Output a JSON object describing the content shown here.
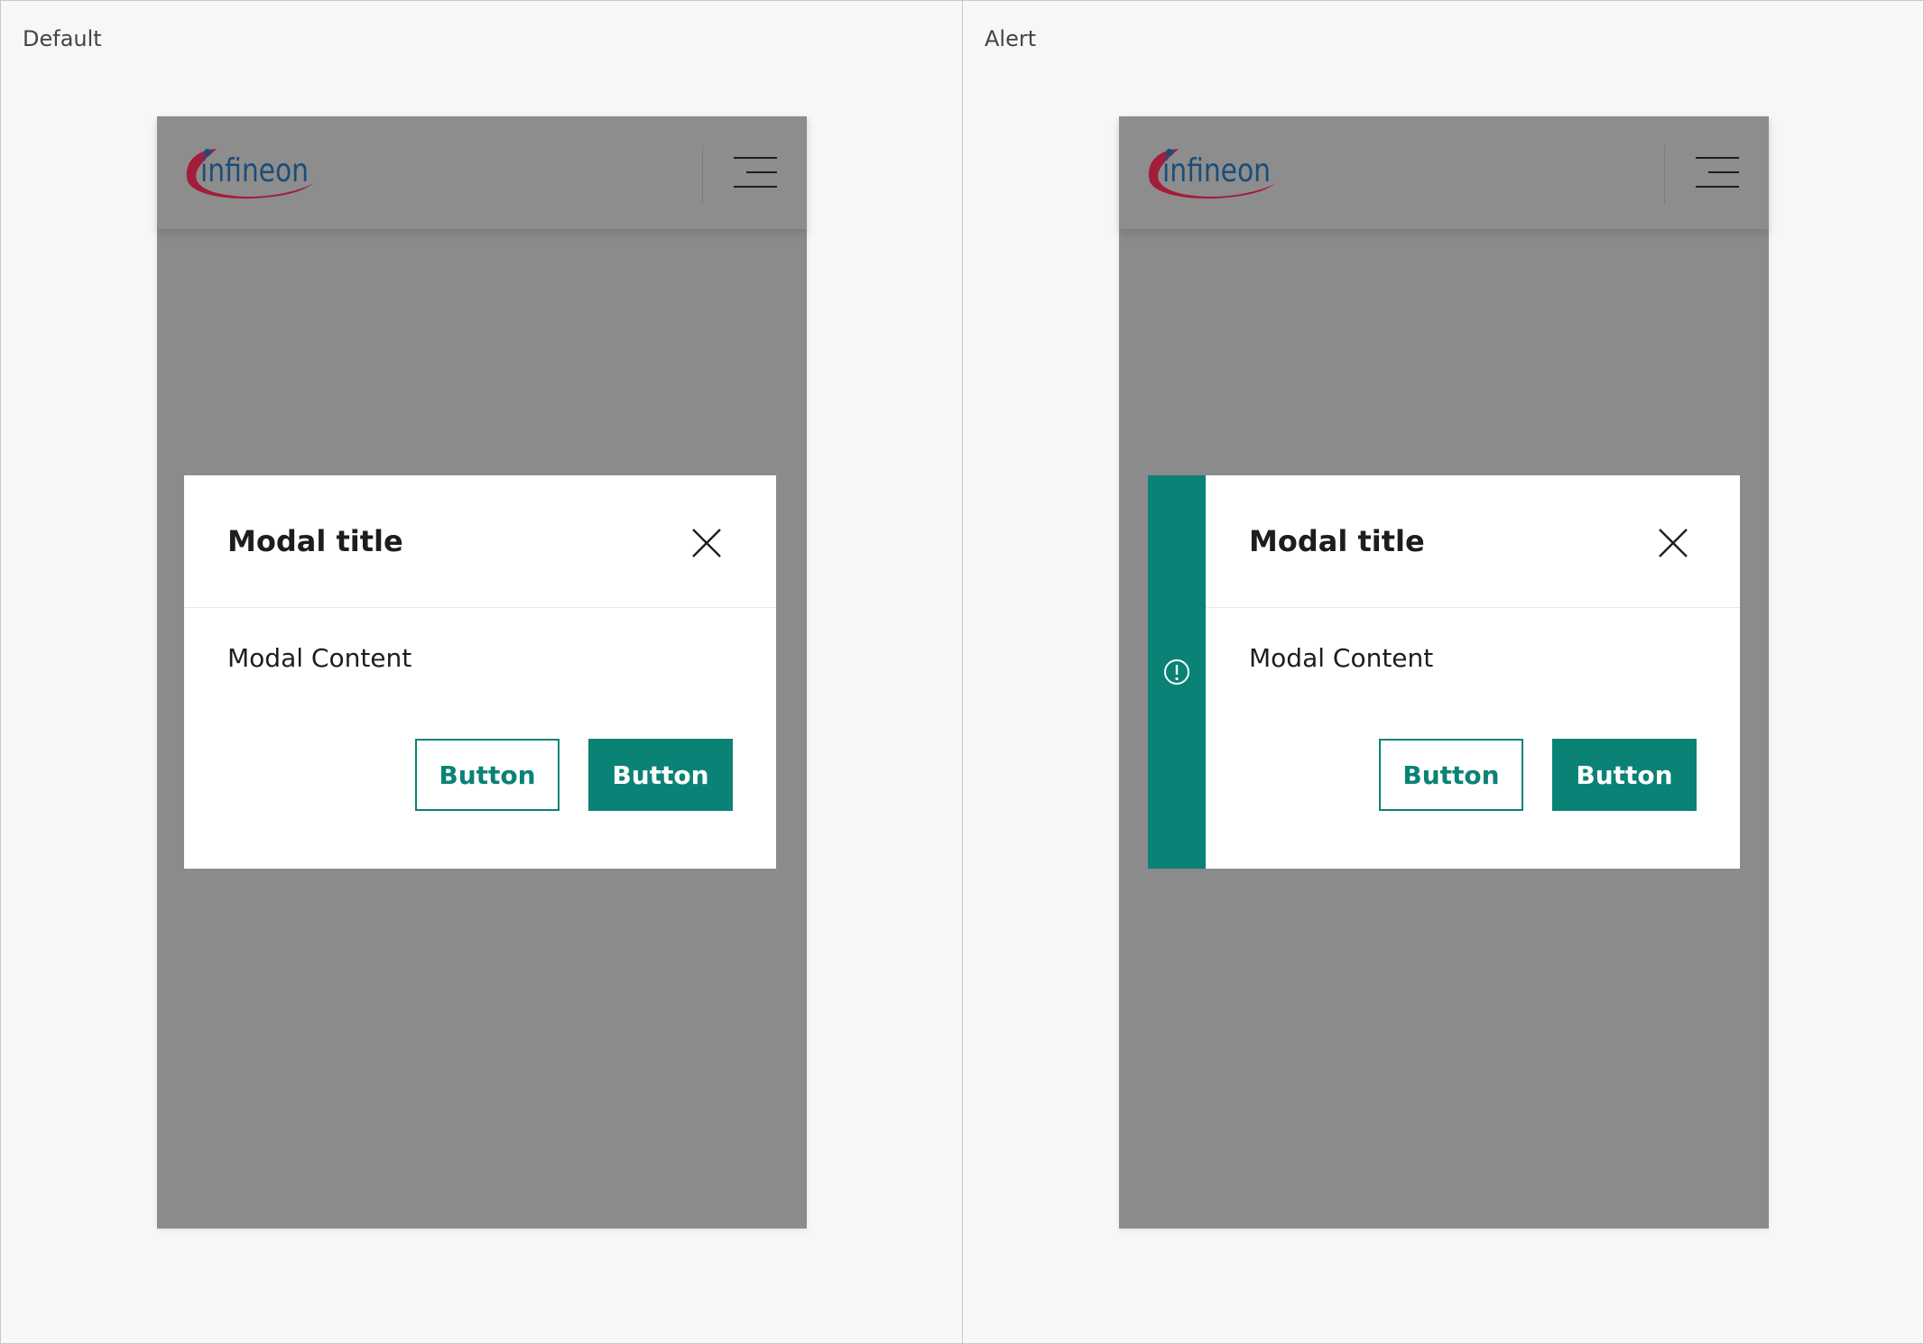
{
  "colors": {
    "accent": "#0a8276",
    "overlay": "#8b8b8b",
    "logo_blue": "#1b4d7a",
    "logo_red": "#a11d3a"
  },
  "panels": [
    {
      "label": "Default",
      "logo_text": "infineon",
      "menu_icon": "hamburger-menu-icon",
      "modal": {
        "title": "Modal title",
        "close_icon": "close-icon",
        "content": "Modal Content",
        "secondary_button": "Button",
        "primary_button": "Button"
      }
    },
    {
      "label": "Alert",
      "logo_text": "infineon",
      "menu_icon": "hamburger-menu-icon",
      "alert_icon": "alert-circle-icon",
      "modal": {
        "title": "Modal title",
        "close_icon": "close-icon",
        "content": "Modal Content",
        "secondary_button": "Button",
        "primary_button": "Button"
      }
    }
  ]
}
